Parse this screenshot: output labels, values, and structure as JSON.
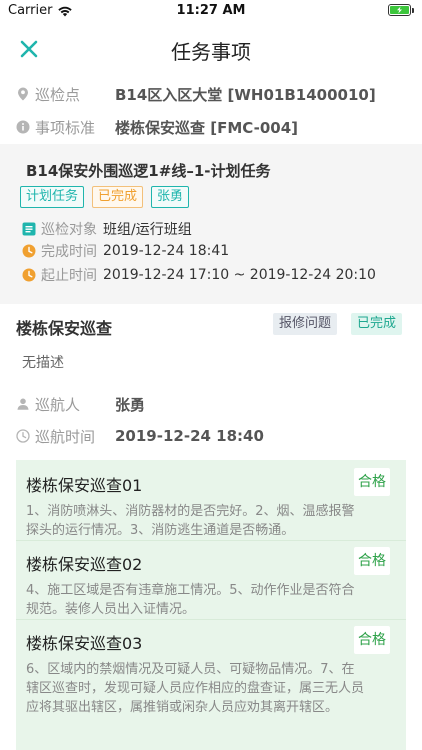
{
  "status_bar": {
    "carrier": "Carrier",
    "time": "11:27 AM"
  },
  "nav": {
    "title": "任务事项"
  },
  "info": {
    "location_label": "巡检点",
    "location_value": "B14区入区大堂 [WH01B1400010]",
    "standard_label": "事项标准",
    "standard_value": "楼栋保安巡查 [FMC-004]"
  },
  "task": {
    "title": "B14保安外围巡逻1#线–1-计划任务",
    "tags": [
      "计划任务",
      "已完成",
      "张勇"
    ],
    "object_label": "巡检对象",
    "object_value": "班组/运行班组",
    "done_label": "完成时间",
    "done_value": "2019-12-24 18:41",
    "range_label": "起止时间",
    "range_value": "2019-12-24 17:10 ~ 2019-12-24 20:10"
  },
  "inspection": {
    "title": "楼栋保安巡查",
    "badge_repair": "报修问题",
    "badge_done": "已完成",
    "no_desc": "无描述",
    "patroller_label": "巡航人",
    "patroller_value": "张勇",
    "time_label": "巡航时间",
    "time_value": "2019-12-24 18:40"
  },
  "checklist": [
    {
      "title": "楼栋保安巡查01",
      "desc": "1、消防喷淋头、消防器材的是否完好。2、烟、温感报警探头的运行情况。3、消防逃生通道是否畅通。",
      "result": "合格"
    },
    {
      "title": "楼栋保安巡查02",
      "desc": "4、施工区域是否有违章施工情况。5、动作作业是否符合规范。装修人员出入证情况。",
      "result": "合格"
    },
    {
      "title": "楼栋保安巡查03",
      "desc": "6、区域内的禁烟情况及可疑人员、可疑物品情况。7、在辖区巡查时，发现可疑人员应作相应的盘查证，属三无人员应将其驱出辖区，属推销或闲杂人员应劝其离开辖区。",
      "result": "合格"
    }
  ],
  "colors": {
    "accent": "#1fb5ad",
    "orange": "#f0a030",
    "pass_green": "#2fa24a"
  }
}
